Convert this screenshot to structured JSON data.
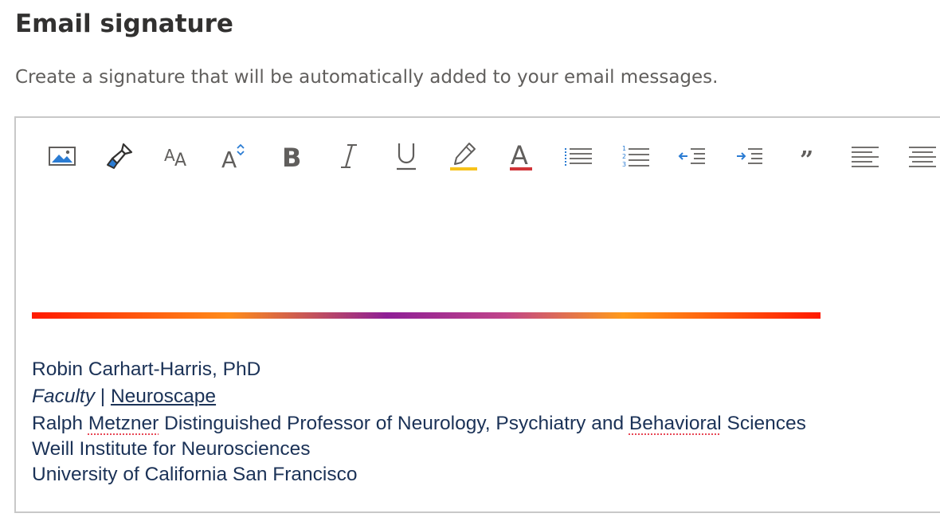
{
  "section": {
    "title": "Email signature",
    "description": "Create a signature that will be automatically added to your email messages."
  },
  "toolbar": {
    "buttons": [
      {
        "name": "insert-picture",
        "icon": "image-icon"
      },
      {
        "name": "format-painter",
        "icon": "paintbrush-icon"
      },
      {
        "name": "font",
        "icon": "font-icon"
      },
      {
        "name": "font-size",
        "icon": "font-size-icon"
      },
      {
        "name": "bold",
        "icon": "bold-icon"
      },
      {
        "name": "italic",
        "icon": "italic-icon"
      },
      {
        "name": "underline",
        "icon": "underline-icon"
      },
      {
        "name": "highlight",
        "icon": "highlighter-icon"
      },
      {
        "name": "font-color",
        "icon": "font-color-icon"
      },
      {
        "name": "bullets",
        "icon": "bullet-list-icon"
      },
      {
        "name": "numbering",
        "icon": "numbered-list-icon"
      },
      {
        "name": "decrease-indent",
        "icon": "outdent-icon"
      },
      {
        "name": "increase-indent",
        "icon": "indent-icon"
      },
      {
        "name": "quote",
        "icon": "quote-icon"
      },
      {
        "name": "align-left",
        "icon": "align-left-icon"
      },
      {
        "name": "align-center",
        "icon": "align-center-icon"
      }
    ],
    "colors": {
      "icon": "#605e5c",
      "accent_blue": "#2b7cd3",
      "highlight_yellow": "#f7c21a",
      "font_red": "#d13438"
    }
  },
  "signature": {
    "name_line": "Robin Carhart-Harris, PhD",
    "role": "Faculty",
    "separator": " | ",
    "org_link": "Neuroscape",
    "title_pre": "Ralph ",
    "title_misspelled_1": "Metzner",
    "title_mid": " Distinguished Professor of Neurology, Psychiatry and ",
    "title_misspelled_2": "Behavioral",
    "title_post": " Sciences",
    "institute": "Weill Institute for Neurosciences",
    "university": "University of California San Francisco",
    "text_color": "#1b3257",
    "rule_colors": [
      "#ff1a00",
      "#ff8c1a",
      "#8e1f96",
      "#ff9a1a",
      "#ff1a00"
    ]
  }
}
